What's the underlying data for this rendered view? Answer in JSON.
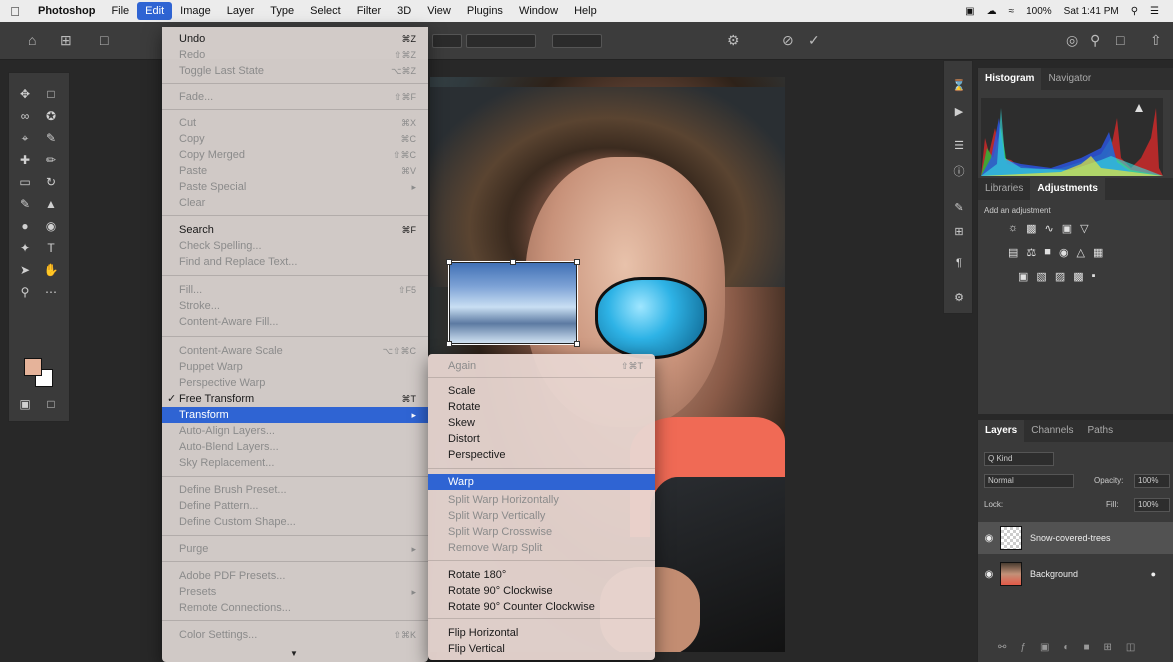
{
  "menubar": {
    "apple": "",
    "items": [
      "Photoshop",
      "File",
      "Edit",
      "Image",
      "Layer",
      "Type",
      "Select",
      "Filter",
      "3D",
      "View",
      "Plugins",
      "Window",
      "Help"
    ],
    "battery": "100%",
    "clock": "Sat 1:41 PM"
  },
  "edit_menu": {
    "items": [
      {
        "label": "Undo",
        "shortcut": "⌘Z",
        "disabled": false
      },
      {
        "label": "Redo",
        "shortcut": "⇧⌘Z",
        "disabled": true
      },
      {
        "label": "Toggle Last State",
        "shortcut": "⌥⌘Z",
        "disabled": true
      },
      {
        "label": "Fade...",
        "shortcut": "⇧⌘F",
        "disabled": true
      },
      {
        "label": "Cut",
        "shortcut": "⌘X",
        "disabled": true
      },
      {
        "label": "Copy",
        "shortcut": "⌘C",
        "disabled": true
      },
      {
        "label": "Copy Merged",
        "shortcut": "⇧⌘C",
        "disabled": true
      },
      {
        "label": "Paste",
        "shortcut": "⌘V",
        "disabled": true
      },
      {
        "label": "Paste Special",
        "shortcut": "▸",
        "disabled": true
      },
      {
        "label": "Clear",
        "shortcut": "",
        "disabled": true
      },
      {
        "label": "Search",
        "shortcut": "⌘F",
        "disabled": false
      },
      {
        "label": "Check Spelling...",
        "shortcut": "",
        "disabled": true
      },
      {
        "label": "Find and Replace Text...",
        "shortcut": "",
        "disabled": true
      },
      {
        "label": "Fill...",
        "shortcut": "⇧F5",
        "disabled": true
      },
      {
        "label": "Stroke...",
        "shortcut": "",
        "disabled": true
      },
      {
        "label": "Content-Aware Fill...",
        "shortcut": "",
        "disabled": true
      },
      {
        "label": "Content-Aware Scale",
        "shortcut": "⌥⇧⌘C",
        "disabled": true
      },
      {
        "label": "Puppet Warp",
        "shortcut": "",
        "disabled": true
      },
      {
        "label": "Perspective Warp",
        "shortcut": "",
        "disabled": true
      },
      {
        "label": "Free Transform",
        "shortcut": "⌘T",
        "disabled": false
      },
      {
        "label": "Transform",
        "shortcut": "▸",
        "disabled": false
      },
      {
        "label": "Auto-Align Layers...",
        "shortcut": "",
        "disabled": true
      },
      {
        "label": "Auto-Blend Layers...",
        "shortcut": "",
        "disabled": true
      },
      {
        "label": "Sky Replacement...",
        "shortcut": "",
        "disabled": true
      },
      {
        "label": "Define Brush Preset...",
        "shortcut": "",
        "disabled": true
      },
      {
        "label": "Define Pattern...",
        "shortcut": "",
        "disabled": true
      },
      {
        "label": "Define Custom Shape...",
        "shortcut": "",
        "disabled": true
      },
      {
        "label": "Purge",
        "shortcut": "▸",
        "disabled": true
      },
      {
        "label": "Adobe PDF Presets...",
        "shortcut": "",
        "disabled": true
      },
      {
        "label": "Presets",
        "shortcut": "▸",
        "disabled": true
      },
      {
        "label": "Remote Connections...",
        "shortcut": "",
        "disabled": true
      },
      {
        "label": "Color Settings...",
        "shortcut": "⇧⌘K",
        "disabled": true
      }
    ]
  },
  "transform_menu": {
    "items": [
      {
        "label": "Again",
        "shortcut": "⇧⌘T",
        "disabled": true
      },
      {
        "label": "Scale",
        "disabled": false
      },
      {
        "label": "Rotate",
        "disabled": false
      },
      {
        "label": "Skew",
        "disabled": false
      },
      {
        "label": "Distort",
        "disabled": false
      },
      {
        "label": "Perspective",
        "disabled": false
      },
      {
        "label": "Warp",
        "disabled": false
      },
      {
        "label": "Split Warp Horizontally",
        "disabled": true
      },
      {
        "label": "Split Warp Vertically",
        "disabled": true
      },
      {
        "label": "Split Warp Crosswise",
        "disabled": true
      },
      {
        "label": "Remove Warp Split",
        "disabled": true
      },
      {
        "label": "Rotate 180°",
        "disabled": false
      },
      {
        "label": "Rotate 90° Clockwise",
        "disabled": false
      },
      {
        "label": "Rotate 90° Counter Clockwise",
        "disabled": false
      },
      {
        "label": "Flip Horizontal",
        "disabled": false
      },
      {
        "label": "Flip Vertical",
        "disabled": false
      }
    ]
  },
  "panels": {
    "histogram_tabs": [
      "Histogram",
      "Navigator"
    ],
    "adjust_tabs": [
      "Libraries",
      "Adjustments"
    ],
    "adjust_subtitle": "Add an adjustment",
    "layers_tabs": [
      "Layers",
      "Channels",
      "Paths"
    ],
    "layers_kind": "Q Kind",
    "blend_mode": "Normal",
    "opacity_label": "Opacity:",
    "opacity": "100%",
    "lock_label": "Lock:",
    "fill_label": "Fill:",
    "fill": "100%",
    "layers": [
      {
        "name": "Snow-covered-trees"
      },
      {
        "name": "Background"
      }
    ]
  },
  "colors": {
    "accent": "#2f64d3",
    "foreground_swatch": "#e5b39a",
    "background_swatch": "#ffffff"
  }
}
